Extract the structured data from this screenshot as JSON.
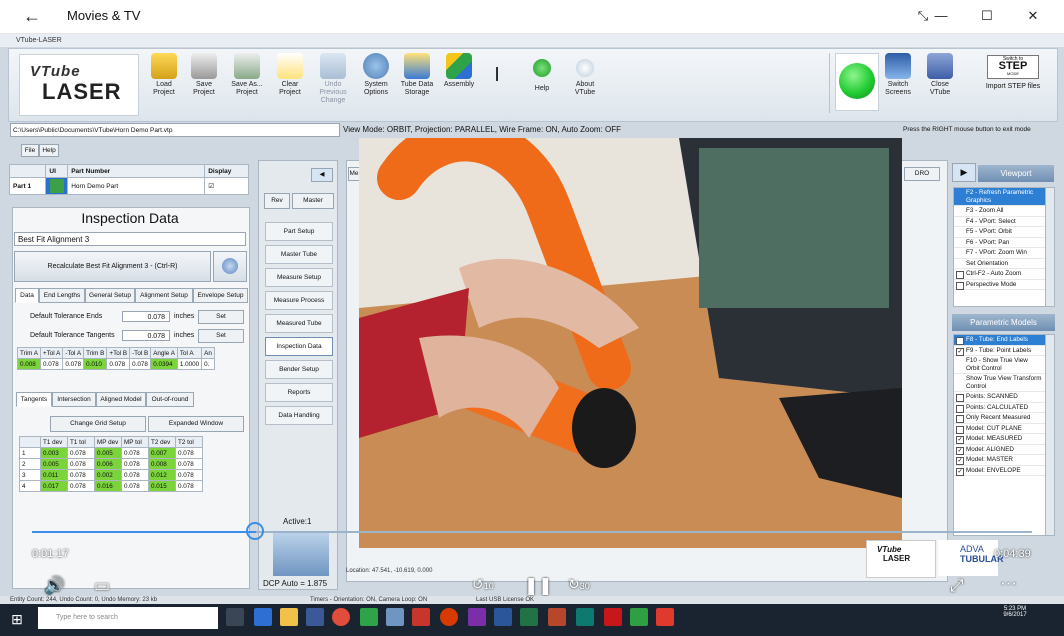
{
  "window": {
    "title": "Movies & TV",
    "back_glyph": "←",
    "expand_glyph": "⤡",
    "min_glyph": "—",
    "max_glyph": "☐",
    "close_glyph": "✕"
  },
  "app": {
    "title": "VTube-LASER",
    "logo_line1": "VTube",
    "logo_line2": "LASER"
  },
  "ribbon": [
    {
      "label": "Load Project"
    },
    {
      "label": "Save Project"
    },
    {
      "label": "Save As... Project"
    },
    {
      "label": "Clear Project"
    },
    {
      "label": "Undo Previous Change"
    },
    {
      "label": "System Options"
    },
    {
      "label": "Tube Data Storage"
    },
    {
      "label": "Assembly"
    },
    {
      "label": "I"
    },
    {
      "label": "Help"
    },
    {
      "label": "About VTube"
    }
  ],
  "ribbon_right": [
    {
      "label": "Switch Screens"
    },
    {
      "label": "Close VTube"
    }
  ],
  "step": {
    "top": "Switch to",
    "big": "STEP",
    "mode": "MODE",
    "label": "Import STEP files"
  },
  "path": "C:\\Users\\Public\\Documents\\VTube\\Horn Demo Part.vtp",
  "file_btn": "File",
  "help_btn": "Help",
  "parts": {
    "headers": [
      "",
      "UI",
      "Part Number",
      "Display"
    ],
    "rows": [
      {
        "name": "Part 1",
        "number": "Horn Demo Part",
        "display": "☑"
      }
    ]
  },
  "inspection": {
    "title": "Inspection Data",
    "alignment": "Best Fit Alignment 3",
    "recalc": "Recalculate Best Fit Alignment 3 - (Ctrl-R)",
    "tabs": [
      "Data",
      "End Lengths",
      "General Setup",
      "Alignment Setup",
      "Envelope Setup"
    ],
    "tol_ends_label": "Default Tolerance Ends",
    "tol_ends_value": "0.078",
    "tol_tan_label": "Default Tolerance Tangents",
    "tol_tan_value": "0.078",
    "unit": "inches",
    "set": "Set",
    "trim_headers": [
      "Trim A",
      "+Tol A",
      "-Tol A",
      "Trim B",
      "+Tol B",
      "-Tol B",
      "Angle A",
      "Tol A",
      "An"
    ],
    "trim_values": [
      "0.008",
      "0.078",
      "0.078",
      "0.010",
      "0.078",
      "0.078",
      "0.0394",
      "1.0000",
      "0."
    ],
    "tabs2": [
      "Tangents",
      "Intersection",
      "Aligned Model",
      "Out-of-round"
    ],
    "change_grid": "Change Grid Setup",
    "expanded": "Expanded Window",
    "tan_headers": [
      "",
      "T1 dev",
      "T1 tol",
      "MP dev",
      "MP tol",
      "T2 dev",
      "T2 tol"
    ],
    "tan_rows": [
      [
        "1",
        "0.003",
        "0.078",
        "0.005",
        "0.078",
        "0.007",
        "0.078"
      ],
      [
        "2",
        "0.005",
        "0.078",
        "0.006",
        "0.078",
        "0.008",
        "0.078"
      ],
      [
        "3",
        "0.011",
        "0.078",
        "0.002",
        "0.078",
        "0.012",
        "0.078"
      ],
      [
        "4",
        "0.017",
        "0.078",
        "0.016",
        "0.078",
        "0.015",
        "0.078"
      ]
    ]
  },
  "middle": {
    "rev": "Rev",
    "master": "Master",
    "items": [
      "Part Setup",
      "Master Tube",
      "Measure Setup",
      "Measure Process",
      "Measured Tube",
      "Inspection Data",
      "Bender Setup",
      "Reports",
      "Data Handling"
    ],
    "active": "Active:1",
    "dcp": "DCP Auto = 1.875"
  },
  "view": {
    "mode": "View Mode: ORBIT, Projection: PARALLEL, Wire Frame: ON, Auto Zoom: OFF",
    "hint": "Press the RIGHT mouse button to exit mode",
    "location": "Location: 47.541, -10.619, 0.000",
    "dro": "DRO",
    "me": "Me"
  },
  "viewport": {
    "title": "Viewport",
    "items": [
      {
        "label": "F2 - Refresh Parametric Graphics",
        "sel": true
      },
      {
        "label": "F3 - Zoom All"
      },
      {
        "label": "F4 - VPort: Select"
      },
      {
        "label": "F5 - VPort: Orbit"
      },
      {
        "label": "F6 - VPort: Pan"
      },
      {
        "label": "F7 - VPort: Zoom Win"
      },
      {
        "label": "Set Orientation"
      },
      {
        "label": "Ctrl-F2 - Auto Zoom",
        "cb": ""
      },
      {
        "label": "Perspective Mode",
        "cb": ""
      }
    ]
  },
  "parametric": {
    "title": "Parametric Models",
    "items": [
      {
        "label": "F8 - Tube: End Labels",
        "sel": true,
        "cb": ""
      },
      {
        "label": "F9 - Tube: Point Labels",
        "cb": "✓"
      },
      {
        "label": "F10 - Show True View Orbit Control"
      },
      {
        "label": "Show True View Transform Control"
      },
      {
        "label": "Points: SCANNED",
        "cb": ""
      },
      {
        "label": "Points: CALCULATED",
        "cb": ""
      },
      {
        "label": "Only Recent Measured",
        "cb": ""
      },
      {
        "label": "Model: CUT PLANE",
        "cb": ""
      },
      {
        "label": "Model: MEASURED",
        "cb": "✓"
      },
      {
        "label": "Model: ALIGNED",
        "cb": "✓"
      },
      {
        "label": "Model: MASTER",
        "cb": "✓"
      },
      {
        "label": "Model: ENVELOPE",
        "cb": "✓"
      }
    ]
  },
  "player": {
    "elapsed": "0:01:17",
    "remaining": "0:04:39",
    "progress_fraction": 0.224,
    "skip_back": "10",
    "skip_fwd": "30",
    "watermark_adv": "ADVA",
    "watermark_tub": "TUBULAR"
  },
  "status": {
    "left": "Entity Count: 244, Undo Count: 0, Undo Memory: 23 kb",
    "mid": "Timers - Orientation: ON, Camera Loop: ON",
    "mid2": "Last USB License OK"
  },
  "taskbar": {
    "search": "Type here to search",
    "time": "5:23 PM",
    "date": "9/6/2017"
  },
  "colors": {
    "accent": "#3b8ee8",
    "green": "#7ad43a",
    "led": "#22cc33"
  }
}
